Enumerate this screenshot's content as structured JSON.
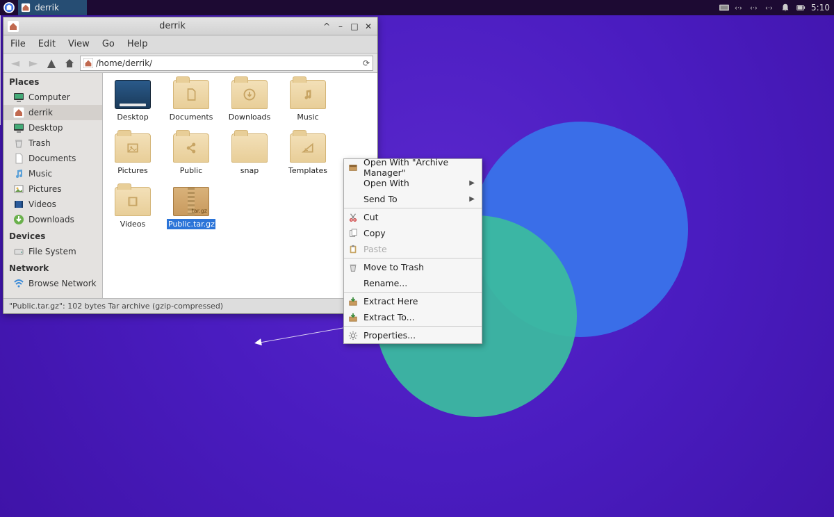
{
  "panel": {
    "task_title": "derrik",
    "clock": "5:10"
  },
  "window": {
    "title": "derrik",
    "menubar": [
      "File",
      "Edit",
      "View",
      "Go",
      "Help"
    ],
    "path": "/home/derrik/",
    "status": "\"Public.tar.gz\": 102 bytes Tar archive (gzip-compressed)"
  },
  "sidebar": {
    "places_header": "Places",
    "places": [
      {
        "label": "Computer",
        "icon": "monitor"
      },
      {
        "label": "derrik",
        "icon": "home",
        "selected": true
      },
      {
        "label": "Desktop",
        "icon": "monitor"
      },
      {
        "label": "Trash",
        "icon": "trash"
      },
      {
        "label": "Documents",
        "icon": "doc"
      },
      {
        "label": "Music",
        "icon": "music"
      },
      {
        "label": "Pictures",
        "icon": "picture"
      },
      {
        "label": "Videos",
        "icon": "video"
      },
      {
        "label": "Downloads",
        "icon": "download"
      }
    ],
    "devices_header": "Devices",
    "devices": [
      {
        "label": "File System",
        "icon": "drive"
      }
    ],
    "network_header": "Network",
    "network": [
      {
        "label": "Browse Network",
        "icon": "wifi"
      }
    ]
  },
  "icons": [
    {
      "label": "Desktop",
      "kind": "desktop"
    },
    {
      "label": "Documents",
      "kind": "folder",
      "glyph": "doc"
    },
    {
      "label": "Downloads",
      "kind": "folder",
      "glyph": "down"
    },
    {
      "label": "Music",
      "kind": "folder",
      "glyph": "music"
    },
    {
      "label": "Pictures",
      "kind": "folder",
      "glyph": "pic"
    },
    {
      "label": "Public",
      "kind": "folder",
      "glyph": "share"
    },
    {
      "label": "snap",
      "kind": "folder",
      "glyph": ""
    },
    {
      "label": "Templates",
      "kind": "folder",
      "glyph": "tmpl"
    },
    {
      "label": "Videos",
      "kind": "folder",
      "glyph": "vid"
    },
    {
      "label": "Public.tar.gz",
      "kind": "archive",
      "selected": true,
      "ext": "tar.gz"
    }
  ],
  "context_menu": [
    {
      "label": "Open With \"Archive Manager\"",
      "icon": "box"
    },
    {
      "label": "Open With",
      "submenu": true
    },
    {
      "label": "Send To",
      "submenu": true
    },
    {
      "sep": true
    },
    {
      "label": "Cut",
      "icon": "cut"
    },
    {
      "label": "Copy",
      "icon": "copy"
    },
    {
      "label": "Paste",
      "icon": "paste",
      "disabled": true
    },
    {
      "sep": true
    },
    {
      "label": "Move to Trash",
      "icon": "trash"
    },
    {
      "label": "Rename..."
    },
    {
      "sep": true
    },
    {
      "label": "Extract Here",
      "icon": "extract"
    },
    {
      "label": "Extract To...",
      "icon": "extract"
    },
    {
      "sep": true
    },
    {
      "label": "Properties...",
      "icon": "gear"
    }
  ]
}
